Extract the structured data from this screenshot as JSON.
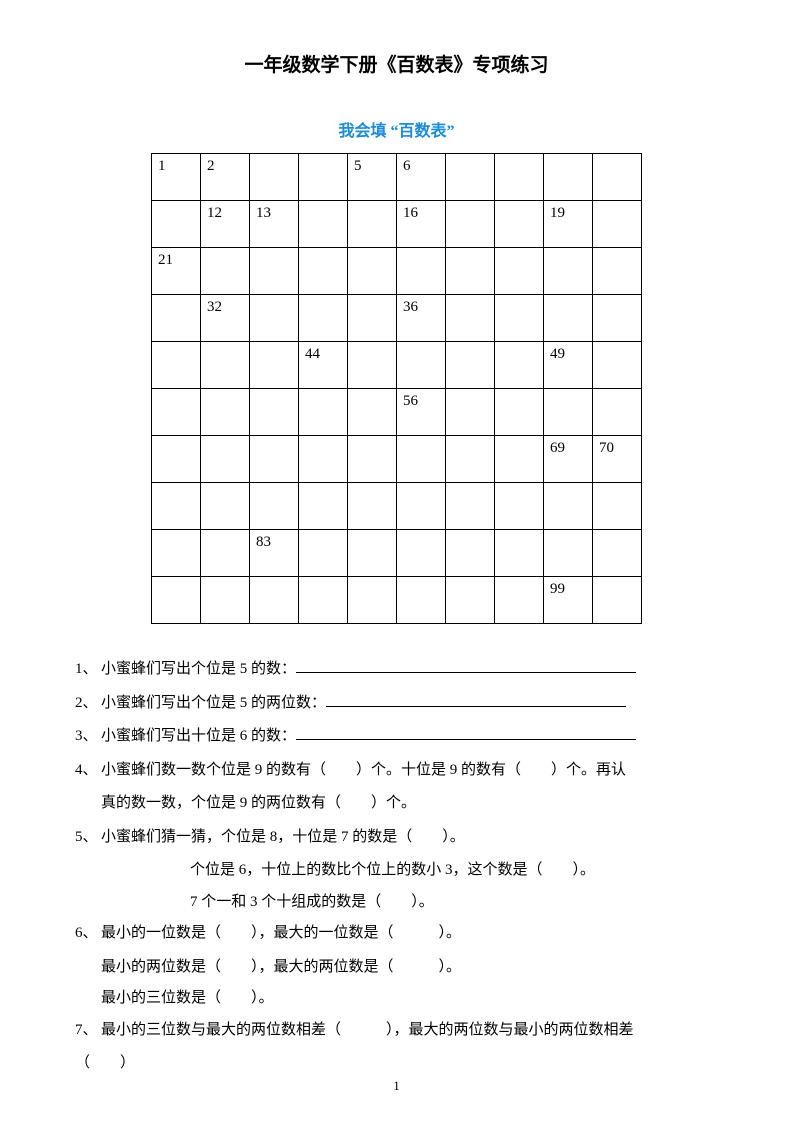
{
  "title": "一年级数学下册《百数表》专项练习",
  "subtitle": "我会填 “百数表”",
  "grid": [
    [
      "1",
      "2",
      "",
      "",
      "5",
      "6",
      "",
      "",
      "",
      ""
    ],
    [
      "",
      "12",
      "13",
      "",
      "",
      "16",
      "",
      "",
      "19",
      ""
    ],
    [
      "21",
      "",
      "",
      "",
      "",
      "",
      "",
      "",
      "",
      ""
    ],
    [
      "",
      "32",
      "",
      "",
      "",
      "36",
      "",
      "",
      "",
      ""
    ],
    [
      "",
      "",
      "",
      "44",
      "",
      "",
      "",
      "",
      "49",
      ""
    ],
    [
      "",
      "",
      "",
      "",
      "",
      "56",
      "",
      "",
      "",
      ""
    ],
    [
      "",
      "",
      "",
      "",
      "",
      "",
      "",
      "",
      "69",
      "70"
    ],
    [
      "",
      "",
      "",
      "",
      "",
      "",
      "",
      "",
      "",
      ""
    ],
    [
      "",
      "",
      "83",
      "",
      "",
      "",
      "",
      "",
      "",
      ""
    ],
    [
      "",
      "",
      "",
      "",
      "",
      "",
      "",
      "",
      "99",
      ""
    ]
  ],
  "q1": {
    "num": "1",
    "text": "小蜜蜂们写出个位是 5 的数："
  },
  "q2": {
    "num": "2",
    "text": "小蜜蜂们写出个位是 5 的两位数："
  },
  "q3": {
    "num": "3",
    "text": "小蜜蜂们写出十位是 6 的数："
  },
  "q4": {
    "num": "4",
    "line1": "小蜜蜂们数一数个位是 9 的数有（　　）个。十位是 9 的数有（　　）个。再认",
    "line2": "真的数一数，个位是 9 的两位数有（　　）个。"
  },
  "q5": {
    "num": "5",
    "line1": "小蜜蜂们猜一猜，个位是 8，十位是 7 的数是（　　）。",
    "line2": "个位是 6，十位上的数比个位上的数小 3，这个数是（　　）。",
    "line3": "7 个一和 3 个十组成的数是（　　）。"
  },
  "q6": {
    "num": "6",
    "line1": "最小的一位数是（　　），最大的一位数是（　　　）。",
    "line2": "最小的两位数是（　　），最大的两位数是（　　　）。",
    "line3": "最小的三位数是（　　）。"
  },
  "q7": {
    "num": "7",
    "line1": "最小的三位数与最大的两位数相差（　　　），最大的两位数与最小的两位数相差",
    "line2": "（　　）"
  },
  "pageNumber": "1"
}
